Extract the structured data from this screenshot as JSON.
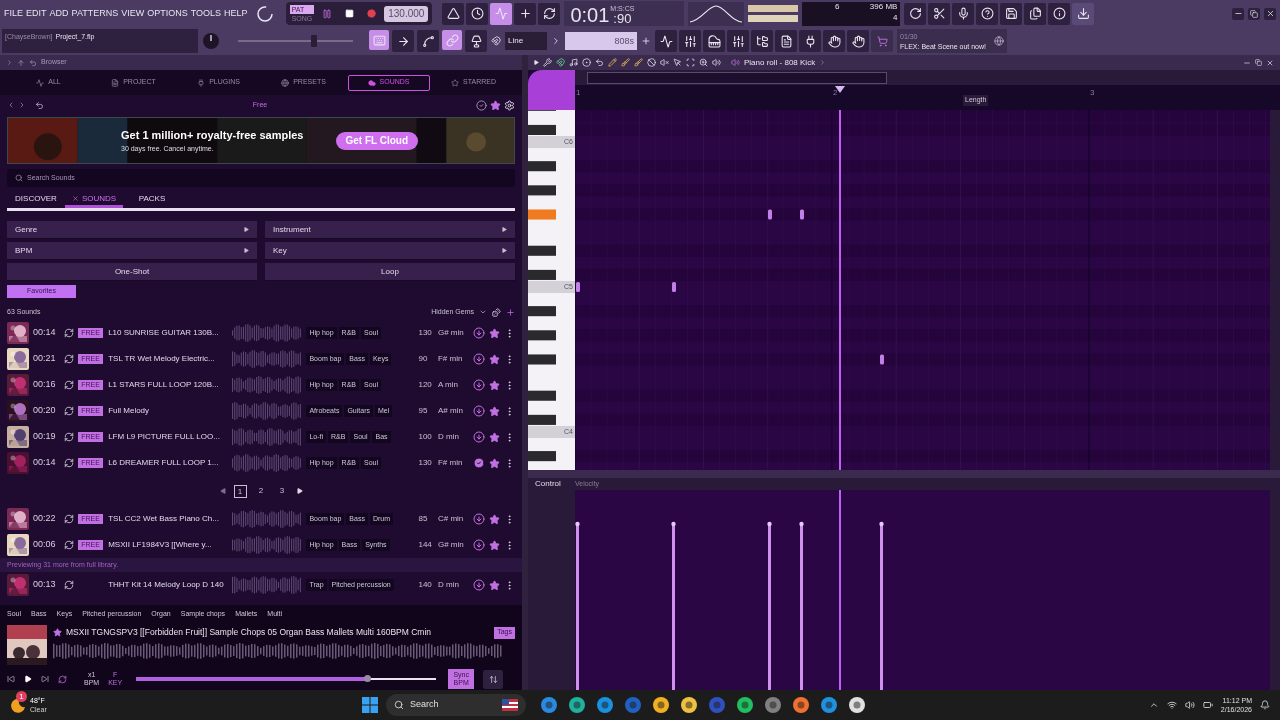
{
  "menu": [
    "FILE",
    "EDIT",
    "ADD",
    "PATTERNS",
    "VIEW",
    "OPTIONS",
    "TOOLS",
    "HELP"
  ],
  "transport": {
    "modes": [
      {
        "label": "PAT",
        "selected": true
      },
      {
        "label": "SONG",
        "selected": false
      }
    ],
    "tempo": "130.000",
    "time": "0:01",
    "time_fraction": ":90",
    "time_unit": "M:S:CS"
  },
  "monitor": {
    "cpu": "6",
    "memory": "396 MB",
    "polyphony": "4"
  },
  "project": {
    "user": "[ChayseBrown]",
    "file": "Project_7.flp"
  },
  "master_pitch": {
    "level": 0.66
  },
  "snap": "Line",
  "pattern": "808s",
  "news": {
    "counter": "01/30",
    "text": "FLEX: Beat Scene out now!"
  },
  "browser": {
    "title": "Browser",
    "tabs": [
      {
        "label": "ALL",
        "selected": false
      },
      {
        "label": "PROJECT",
        "selected": false
      },
      {
        "label": "PLUGINS",
        "selected": false
      },
      {
        "label": "PRESETS",
        "selected": false
      },
      {
        "label": "SOUNDS",
        "selected": true
      },
      {
        "label": "STARRED",
        "selected": false
      }
    ],
    "plan": "Free",
    "banner": {
      "title": "Get 1 million+ royalty-free samples",
      "subtitle": "30 days free. Cancel anytime.",
      "button": "Get FL Cloud"
    },
    "search": {
      "placeholder": "Search Sounds"
    },
    "subtabs": [
      {
        "label": "DISCOVER",
        "selected": false
      },
      {
        "label": "SOUNDS",
        "selected": true
      },
      {
        "label": "PACKS",
        "selected": false
      }
    ],
    "filters": [
      {
        "label": "Genre",
        "kind": "menu"
      },
      {
        "label": "Instrument",
        "kind": "menu"
      },
      {
        "label": "BPM",
        "kind": "menu"
      },
      {
        "label": "Key",
        "kind": "menu"
      },
      {
        "label": "One-Shot",
        "kind": "toggle"
      },
      {
        "label": "Loop",
        "kind": "toggle"
      }
    ],
    "favorites": {
      "label": "Favorites",
      "on": true
    },
    "count": "63 Sounds",
    "sort": "Hidden Gems",
    "sounds": [
      {
        "time": "00:14",
        "badge": "FREE",
        "title": "L10 SUNRISE GUITAR 130B...",
        "tags": [
          "Hip hop",
          "R&B",
          "Soul"
        ],
        "bpm": "130",
        "key": "G# min",
        "downloaded": false,
        "starred": true
      },
      {
        "time": "00:21",
        "badge": "FREE",
        "title": "TSL TR Wet Melody Electric...",
        "tags": [
          "Boom bap",
          "Bass",
          "Keys"
        ],
        "bpm": "90",
        "key": "F# min",
        "downloaded": false,
        "starred": true
      },
      {
        "time": "00:16",
        "badge": "FREE",
        "title": "L1 STARS FULL LOOP 120B...",
        "tags": [
          "Hip hop",
          "R&B",
          "Soul"
        ],
        "bpm": "120",
        "key": "A min",
        "downloaded": false,
        "starred": true
      },
      {
        "time": "00:20",
        "badge": "FREE",
        "title": "Full Melody",
        "tags": [
          "Afrobeats",
          "Guitars",
          "Mel"
        ],
        "bpm": "95",
        "key": "A# min",
        "downloaded": false,
        "starred": true
      },
      {
        "time": "00:19",
        "badge": "FREE",
        "title": "LFM L9 PICTURE FULL LOO...",
        "tags": [
          "Lo-fi",
          "R&B",
          "Soul",
          "Bas"
        ],
        "bpm": "100",
        "key": "D min",
        "downloaded": false,
        "starred": true
      },
      {
        "time": "00:14",
        "badge": "FREE",
        "title": "L6 DREAMER FULL LOOP 1...",
        "tags": [
          "Hip hop",
          "R&B",
          "Soul"
        ],
        "bpm": "130",
        "key": "F# min",
        "downloaded": true,
        "starred": true
      }
    ],
    "pages": [
      {
        "label": "1",
        "selected": true
      },
      {
        "label": "2",
        "selected": false
      },
      {
        "label": "3",
        "selected": false
      }
    ],
    "more_sounds": [
      {
        "time": "00:22",
        "badge": "FREE",
        "title": "TSL CC2 Wet Bass Piano Ch...",
        "tags": [
          "Boom bap",
          "Bass",
          "Drum"
        ],
        "bpm": "85",
        "key": "C# min",
        "downloaded": false,
        "starred": true
      },
      {
        "time": "00:06",
        "badge": "FREE",
        "title": "MSXII LF1984V3 [[Where y...",
        "tags": [
          "Hip hop",
          "Bass",
          "Synths"
        ],
        "bpm": "144",
        "key": "G# min",
        "downloaded": false,
        "starred": true
      }
    ],
    "preview_note": "Previewing 31 more from full library.",
    "library_sounds": [
      {
        "time": "00:13",
        "title": "THHT Kit 14 Melody Loop D 140",
        "tags": [
          "Trap",
          "Pitched percussion"
        ],
        "bpm": "140",
        "key": "D min",
        "downloaded": false,
        "starred": true
      }
    ],
    "player": {
      "tags": [
        "Soul",
        "Bass",
        "Keys",
        "Pitched percussion",
        "Organ",
        "Sample chops",
        "Mallets",
        "Multi"
      ],
      "title": "MSXII TGNGSPV3 [[Forbidden Fruit]] Sample Chops 05 Organ Bass Mallets Multi 160BPM Cmin",
      "tags_button": "Tags",
      "speed": "x1",
      "speed_unit": "BPM",
      "key": "F",
      "key_unit": "KEY",
      "level": 0.77,
      "sync": "Sync BPM"
    }
  },
  "piano_roll": {
    "title": "Piano roll - 808 Kick",
    "ruler": [
      "1",
      "2",
      "3"
    ],
    "length_label": "Length",
    "key_labels": [
      "C6",
      "C5",
      "C4"
    ],
    "control_label": "Control",
    "control_param": "Velocity"
  },
  "taskbar": {
    "weather_badge": "1",
    "temperature": "48°F",
    "condition": "Clear",
    "search": "Search",
    "time": "11:12 PM",
    "date": "2/16/2026"
  }
}
